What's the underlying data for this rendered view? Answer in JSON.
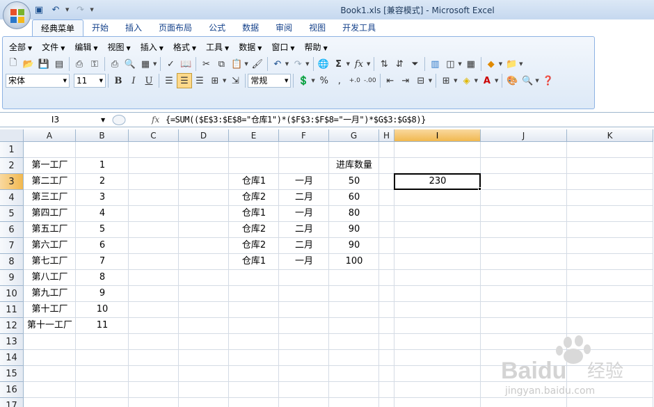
{
  "app": {
    "title": "Book1.xls  [兼容模式] - Microsoft Excel"
  },
  "ribbon_tabs": [
    "经典菜单",
    "开始",
    "插入",
    "页面布局",
    "公式",
    "数据",
    "审阅",
    "视图",
    "开发工具"
  ],
  "active_tab": "经典菜单",
  "classic_menu": [
    "全部",
    "文件",
    "编辑",
    "视图",
    "插入",
    "格式",
    "工具",
    "数据",
    "窗口",
    "帮助"
  ],
  "font": {
    "name": "宋体",
    "size": "11"
  },
  "number_format": "常规",
  "formula_bar": {
    "name_box": "I3",
    "fx_label": "fx",
    "formula": "{=SUM(($E$3:$E$8=\"仓库1\")*($F$3:$F$8=\"一月\")*$G$3:$G$8)}"
  },
  "sheet": {
    "columns": [
      "A",
      "B",
      "C",
      "D",
      "E",
      "F",
      "G",
      "H",
      "I",
      "J",
      "K"
    ],
    "rows": [
      "1",
      "2",
      "3",
      "4",
      "5",
      "6",
      "7",
      "8",
      "9",
      "10",
      "11",
      "12",
      "13",
      "14",
      "15",
      "16",
      "17"
    ],
    "selected_column": "I",
    "selected_row": "3",
    "colA": [
      "",
      "第一工厂",
      "第二工厂",
      "第三工厂",
      "第四工厂",
      "第五工厂",
      "第六工厂",
      "第七工厂",
      "第八工厂",
      "第九工厂",
      "第十工厂",
      "第十一工厂"
    ],
    "colB": [
      "",
      "1",
      "2",
      "3",
      "4",
      "5",
      "6",
      "7",
      "8",
      "9",
      "10",
      "11"
    ],
    "colE": [
      "",
      "",
      "仓库1",
      "仓库2",
      "仓库1",
      "仓库2",
      "仓库2",
      "仓库1"
    ],
    "colF": [
      "",
      "",
      "一月",
      "二月",
      "一月",
      "二月",
      "二月",
      "一月"
    ],
    "colG": [
      "",
      "进库数量",
      "50",
      "60",
      "80",
      "90",
      "90",
      "100"
    ],
    "I3": "230"
  },
  "watermark": {
    "brand": "Baidu",
    "brand_cn": "经验",
    "url": "jingyan.baidu.com"
  }
}
